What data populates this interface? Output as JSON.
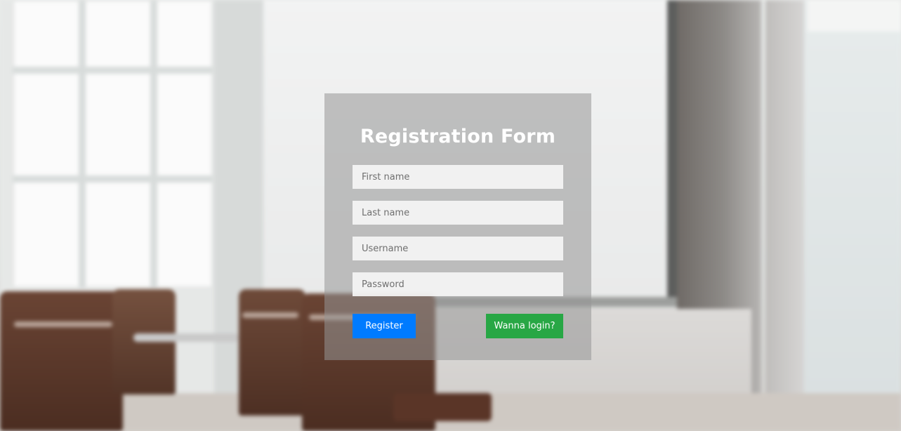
{
  "form": {
    "title": "Registration Form",
    "fields": [
      {
        "placeholder": "First name",
        "value": ""
      },
      {
        "placeholder": "Last name",
        "value": ""
      },
      {
        "placeholder": "Username",
        "value": ""
      },
      {
        "placeholder": "Password",
        "value": ""
      }
    ],
    "register_label": "Register",
    "login_label": "Wanna login?"
  },
  "colors": {
    "register_button": "#007bff",
    "login_button": "#28a745",
    "title_text": "#ffffff"
  }
}
